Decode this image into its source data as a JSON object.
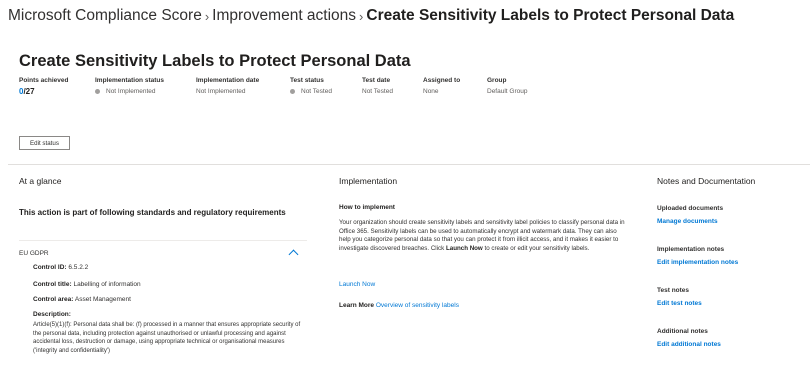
{
  "breadcrumb": {
    "root": "Microsoft Compliance Score",
    "section": "Improvement actions",
    "current": "Create Sensitivity Labels to Protect Personal Data",
    "separator": "›"
  },
  "page_title": "Create Sensitivity Labels to Protect Personal Data",
  "meta": {
    "points_label": "Points achieved",
    "points_achieved": "0",
    "points_total": "/27",
    "impl_status_label": "Implementation status",
    "impl_status_value": "Not Implemented",
    "impl_date_label": "Implementation date",
    "impl_date_value": "Not Implemented",
    "test_status_label": "Test status",
    "test_status_value": "Not Tested",
    "test_date_label": "Test date",
    "test_date_value": "Not Tested",
    "assigned_label": "Assigned to",
    "assigned_value": "None",
    "group_label": "Group",
    "group_value": "Default Group"
  },
  "edit_status_label": "Edit status",
  "at_a_glance": {
    "heading": "At a glance",
    "standards_title": "This action is part of following standards and regulatory requirements",
    "standard_name": "EU GDPR",
    "control_id_label": "Control ID:",
    "control_id_value": "6.5.2.2",
    "control_title_label": "Control title:",
    "control_title_value": "Labelling of information",
    "control_area_label": "Control area:",
    "control_area_value": "Asset Management",
    "description_label": "Description:",
    "description_text": "Article(5)(1)(f): Personal data shall be: (f) processed in a manner that ensures appropriate security of the personal data, including protection against unauthorised or unlawful processing and against accidental loss, destruction or damage, using appropriate technical or organisational measures ('integrity and confidentiality')"
  },
  "implementation": {
    "heading": "Implementation",
    "how_label": "How to implement",
    "body_pre": "Your organization should create sensitivity labels and sensitivity label policies to classify personal data in Office 365. Sensitivity labels can be used to automatically encrypt and watermark data. They can also help you categorize personal data so that you can protect it from illicit access, and it makes it easier to investigate discovered breaches. Click ",
    "body_bold": "Launch Now",
    "body_post": " to create or edit your sensitivity labels.",
    "launch_link": "Launch Now",
    "learn_more_label": "Learn More",
    "learn_more_link": "Overview of sensitivity labels"
  },
  "notes": {
    "heading": "Notes and Documentation",
    "uploaded_label": "Uploaded documents",
    "uploaded_link": "Manage documents",
    "impl_notes_label": "Implementation notes",
    "impl_notes_link": "Edit implementation notes",
    "test_notes_label": "Test notes",
    "test_notes_link": "Edit test notes",
    "additional_label": "Additional notes",
    "additional_link": "Edit additional notes"
  },
  "colors": {
    "accent": "#0078d4",
    "status_dot": "#a19f9d",
    "text": "#323130"
  }
}
